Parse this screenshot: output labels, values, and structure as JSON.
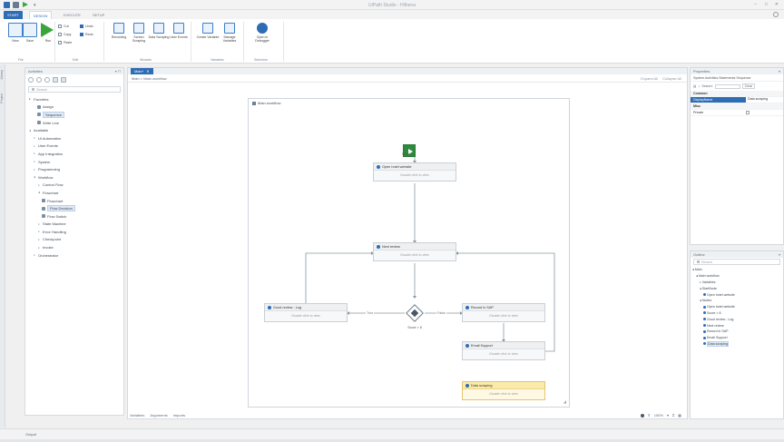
{
  "window": {
    "title": "UiPath Studio - Hilhena",
    "controls": [
      "–",
      "□",
      "✕"
    ]
  },
  "quick_access": [
    "save-icon",
    "undo-icon",
    "run-icon",
    "dropdown-icon"
  ],
  "ribbon": {
    "tabs": [
      "START",
      "DESIGN",
      "EXECUTE",
      "SETUP"
    ],
    "active_tab": "DESIGN",
    "buttons": {
      "new": "New",
      "save": "Save",
      "run": "Run",
      "recording": "Recording",
      "screen_scraping": "Screen Scraping",
      "data_scraping": "Data Scraping",
      "user_events": "User Events",
      "create_variable": "Create Variable",
      "manage_variables": "Manage Variables",
      "open_in_debugger": "Open in Debugger"
    },
    "small_buttons": {
      "cut": "Cut",
      "copy": "Copy",
      "paste": "Paste",
      "undo": "Undo",
      "redo": "Redo"
    },
    "groups": [
      "File",
      "Edit",
      "Wizards",
      "Variables",
      "Selectors"
    ]
  },
  "left_strip": [
    "Library",
    "Project"
  ],
  "activities": {
    "title": "Activities",
    "search_placeholder": "Search",
    "tree": [
      {
        "label": "Favorites",
        "level": 0,
        "arrow": "▸",
        "expanded": true
      },
      {
        "label": "Assign",
        "level": 2,
        "icon": true
      },
      {
        "label": "Sequence",
        "level": 2,
        "icon": true,
        "selected": true
      },
      {
        "label": "Write Line",
        "level": 2,
        "icon": true
      },
      {
        "label": "Available",
        "level": 0,
        "arrow": "◂",
        "expanded": true
      },
      {
        "label": "UI Automation",
        "level": 1,
        "arrow": "▹"
      },
      {
        "label": "User Events",
        "level": 1,
        "arrow": "▹"
      },
      {
        "label": "App Integration",
        "level": 1,
        "arrow": "▹"
      },
      {
        "label": "System",
        "level": 1,
        "arrow": "▹"
      },
      {
        "label": "Programming",
        "level": 1,
        "arrow": "▹"
      },
      {
        "label": "Workflow",
        "level": 1,
        "arrow": "◂"
      },
      {
        "label": "Control Flow",
        "level": 2,
        "arrow": "▹"
      },
      {
        "label": "Flowchart",
        "level": 2,
        "arrow": "◂"
      },
      {
        "label": "Flowchart",
        "level": 3,
        "icon": true
      },
      {
        "label": "Flow Decision",
        "level": 3,
        "icon": true,
        "selected": true
      },
      {
        "label": "Flow Switch",
        "level": 3,
        "icon": true
      },
      {
        "label": "State Machine",
        "level": 2,
        "arrow": "▹"
      },
      {
        "label": "Error Handling",
        "level": 2,
        "arrow": "▹"
      },
      {
        "label": "Checkpoint",
        "level": 2,
        "arrow": "▹"
      },
      {
        "label": "Invoke",
        "level": 2,
        "arrow": "▹"
      },
      {
        "label": "Orchestrator",
        "level": 1,
        "arrow": "▹"
      }
    ]
  },
  "designer": {
    "tab": "Main*",
    "breadcrumb": "Main > Main workflow",
    "expand_all": "Expand All",
    "collapse_all": "Collapse All",
    "flowchart_title": "Main workflow",
    "start_label": "Start",
    "double_click": "Double click to view",
    "activities": [
      {
        "id": "open",
        "title": "Open hotel website"
      },
      {
        "id": "next",
        "title": "Next review"
      },
      {
        "id": "good",
        "title": "Good review - Log"
      },
      {
        "id": "record",
        "title": "Record in SAP"
      },
      {
        "id": "email",
        "title": "Email Support"
      },
      {
        "id": "scrape",
        "title": "Data scraping"
      }
    ],
    "decision_label": "Score > 8",
    "true_label": "True",
    "false_label": "False",
    "bottom_tabs": [
      "Variables",
      "Arguments",
      "Imports"
    ],
    "zoom": "100%"
  },
  "properties": {
    "title": "Properties",
    "class_name": "System.Activities.Statements.Sequence",
    "search": "Search:",
    "clear": "Clear",
    "categories": [
      {
        "name": "Common",
        "rows": [
          {
            "key": "DisplayName",
            "value": "Data scraping",
            "selected": true
          }
        ]
      },
      {
        "name": "Misc",
        "rows": [
          {
            "key": "Private",
            "value": ""
          }
        ]
      }
    ]
  },
  "outline": {
    "title": "Outline",
    "search_placeholder": "Search",
    "tree": [
      {
        "label": "Main",
        "level": 0,
        "arrow": "◂"
      },
      {
        "label": "Main workflow",
        "level": 1,
        "arrow": "◂"
      },
      {
        "label": "Variables",
        "level": 2,
        "arrow": "▹"
      },
      {
        "label": "StartNode",
        "level": 2,
        "arrow": "◂"
      },
      {
        "label": "Open hotel website",
        "level": 3,
        "icon": true
      },
      {
        "label": "Nodes",
        "level": 2,
        "arrow": "◂"
      },
      {
        "label": "Open hotel website",
        "level": 3,
        "icon": true
      },
      {
        "label": "Score > 8",
        "level": 3,
        "icon": true
      },
      {
        "label": "Good review - Log",
        "level": 3,
        "icon": true
      },
      {
        "label": "Next review",
        "level": 3,
        "icon": true
      },
      {
        "label": "Record in SAP",
        "level": 3,
        "icon": true
      },
      {
        "label": "Email Support",
        "level": 3,
        "icon": true
      },
      {
        "label": "Data scraping",
        "level": 3,
        "icon": true,
        "selected": true
      }
    ]
  },
  "output": {
    "tab": "Output"
  },
  "colors": {
    "accent": "#2e6cb5",
    "start_green": "#2e8b3d",
    "highlight": "#fbeaa9"
  }
}
